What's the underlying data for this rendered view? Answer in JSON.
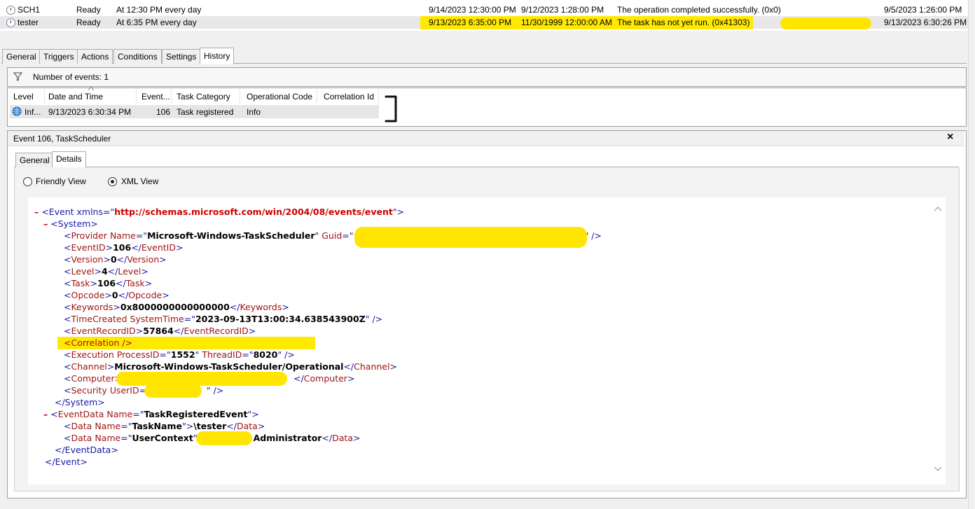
{
  "tasks": {
    "rows": [
      {
        "name": "SCH1",
        "status": "Ready",
        "trigger": "At 12:30 PM every day",
        "next_run": "9/14/2023 12:30:00 PM",
        "last_run": "9/12/2023 1:28:00 PM",
        "result": "The operation completed successfully. (0x0)",
        "created": "9/5/2023 1:26:00 PM"
      },
      {
        "name": "tester",
        "status": "Ready",
        "trigger": "At 6:35 PM every day",
        "next_run": "9/13/2023 6:35:00 PM",
        "last_run": "11/30/1999 12:00:00 AM",
        "result": "The task has not yet run. (0x41303)",
        "created": "9/13/2023 6:30:26 PM"
      }
    ]
  },
  "tabs": [
    "General",
    "Triggers",
    "Actions",
    "Conditions",
    "Settings",
    "History"
  ],
  "history": {
    "filter_label": "Number of events: 1",
    "columns": [
      "Level",
      "Date and Time",
      "Event...",
      "Task Category",
      "Operational Code",
      "Correlation Id"
    ],
    "rows": [
      {
        "level": "Inf...",
        "datetime": "9/13/2023 6:30:34 PM",
        "event": "106",
        "category": "Task registered",
        "opcode": "Info"
      }
    ]
  },
  "event_detail": {
    "title": "Event 106, TaskScheduler",
    "close": "×",
    "subtabs": [
      "General",
      "Details"
    ],
    "view_options": [
      "Friendly View",
      "XML View"
    ],
    "selected_view": "XML View"
  },
  "xml": {
    "collapse": "–",
    "event_open": "<Event xmlns=\"",
    "event_ns": "http://schemas.microsoft.com/win/2004/08/events/event",
    "system_open": "<System>",
    "provider_name": "Microsoft-Windows-TaskScheduler",
    "event_id": "106",
    "version": "0",
    "level": "4",
    "task": "106",
    "opcode": "0",
    "keywords": "0x8000000000000000",
    "system_time": "2023-09-13T13:00:34.638543900Z",
    "record_id": "57864",
    "correlation": "<Correlation />",
    "process_id": "1552",
    "thread_id": "8020",
    "channel": "Microsoft-Windows-TaskScheduler/Operational",
    "system_close": "</System>",
    "eventdata_name": "TaskRegisteredEvent",
    "task_name_value": "\\tester",
    "user_context_value": "Administrator",
    "eventdata_close": "</EventData>",
    "event_close": "</Event>"
  }
}
